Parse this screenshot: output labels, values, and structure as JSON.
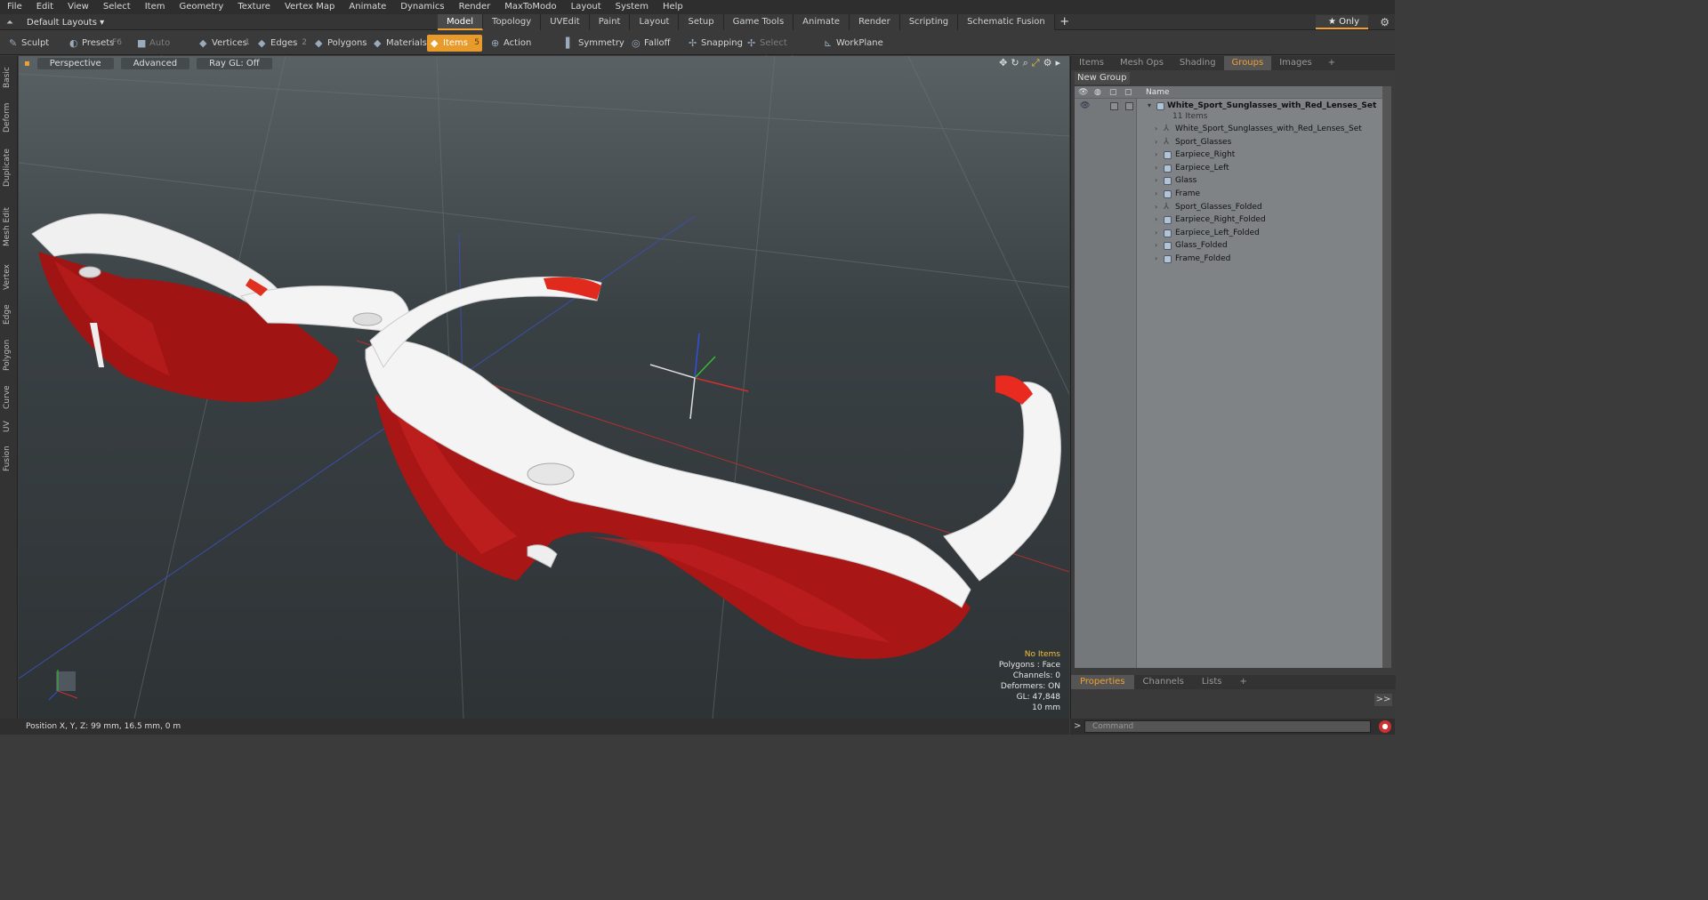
{
  "menu": [
    "File",
    "Edit",
    "View",
    "Select",
    "Item",
    "Geometry",
    "Texture",
    "Vertex Map",
    "Animate",
    "Dynamics",
    "Render",
    "MaxToModo",
    "Layout",
    "System",
    "Help"
  ],
  "layout": {
    "selector": "Default Layouts ▾",
    "tabs": [
      "Model",
      "Topology",
      "UVEdit",
      "Paint",
      "Layout",
      "Setup",
      "Game Tools",
      "Animate",
      "Render",
      "Scripting",
      "Schematic Fusion"
    ],
    "active_tab": "Model",
    "only_label": "★  Only"
  },
  "toolbar": {
    "sculpt": "Sculpt",
    "presets": "Presets",
    "presets_key": "F6",
    "auto_select": "Auto Select",
    "vertices": "Vertices",
    "vertices_count": "1",
    "edges": "Edges",
    "edges_count": "2",
    "polygons": "Polygons",
    "materials": "Materials",
    "items": "Items",
    "items_count": "5",
    "action_center": "Action Center",
    "symmetry": "Symmetry",
    "falloff": "Falloff",
    "snapping": "Snapping",
    "select_through": "Select Through",
    "workplane": "WorkPlane"
  },
  "left_tabs": [
    "Basic",
    "Deform",
    "Duplicate",
    "Mesh Edit",
    "Vertex",
    "Edge",
    "Polygon",
    "Curve",
    "UV",
    "Fusion"
  ],
  "viewport": {
    "perspective": "Perspective",
    "advanced": "Advanced",
    "raygl": "Ray GL: Off"
  },
  "hud": {
    "no_items": "No Items",
    "polygons": "Polygons : Face",
    "channels": "Channels: 0",
    "deformers": "Deformers: ON",
    "gl": "GL: 47,848",
    "scale": "10 mm"
  },
  "right_tabs": [
    "Items",
    "Mesh Ops",
    "Shading",
    "Groups",
    "Images"
  ],
  "right_active": "Groups",
  "new_group": "New Group",
  "list_header": {
    "name": "Name"
  },
  "group": {
    "name": "White_Sport_Sunglasses_with_Red_Lenses_Set",
    "count": "11 Items"
  },
  "items": [
    {
      "label": "White_Sport_Sunglasses_with_Red_Lenses_Set",
      "type": "locator"
    },
    {
      "label": "Sport_Glasses",
      "type": "locator"
    },
    {
      "label": "Earpiece_Right",
      "type": "mesh"
    },
    {
      "label": "Earpiece_Left",
      "type": "mesh"
    },
    {
      "label": "Glass",
      "type": "mesh"
    },
    {
      "label": "Frame",
      "type": "mesh"
    },
    {
      "label": "Sport_Glasses_Folded",
      "type": "locator"
    },
    {
      "label": "Earpiece_Right_Folded",
      "type": "mesh"
    },
    {
      "label": "Earpiece_Left_Folded",
      "type": "mesh"
    },
    {
      "label": "Glass_Folded",
      "type": "mesh"
    },
    {
      "label": "Frame_Folded",
      "type": "mesh"
    }
  ],
  "bottom_tabs": [
    "Properties",
    "Channels",
    "Lists"
  ],
  "bottom_active": "Properties",
  "status": "Position X, Y, Z:  99 mm, 16.5 mm, 0 m",
  "command_placeholder": "Command",
  "colors": {
    "accent": "#f0a030",
    "lens_red": "#b01818",
    "frame_white": "#f2f2f2"
  }
}
